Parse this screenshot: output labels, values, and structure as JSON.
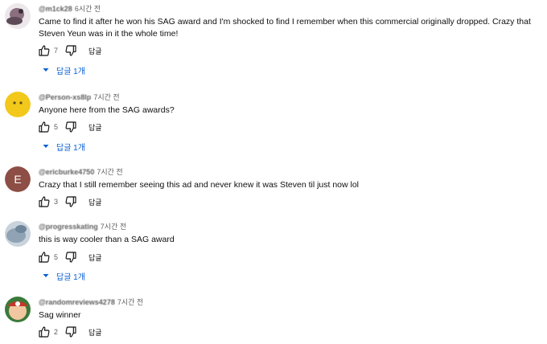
{
  "comments": [
    {
      "author": "@m1ck28",
      "time": "6시간 전",
      "text": "Came to find it after he won his SAG award and I'm shocked to find I remember when this commercial originally dropped. Crazy that Steven Yeun was in it the whole time!",
      "likes": "7",
      "reply_label": "답글",
      "replies_label": "답글 1개",
      "avatar": {
        "type": "image",
        "color": "#8a6f7f"
      }
    },
    {
      "author": "@Person-xs8lp",
      "time": "7시간 전",
      "text": "Anyone here from the SAG awards?",
      "likes": "5",
      "reply_label": "답글",
      "replies_label": "답글 1개",
      "avatar": {
        "type": "emoji",
        "color": "#f2c81a"
      }
    },
    {
      "author": "@ericburke4750",
      "time": "7시간 전",
      "text": "Crazy that I still remember seeing this ad and never knew it was Steven til just now lol",
      "likes": "3",
      "reply_label": "답글",
      "replies_label": "",
      "avatar": {
        "type": "letter",
        "letter": "E",
        "color": "#8d4e45"
      }
    },
    {
      "author": "@progresskating",
      "time": "7시간 전",
      "text": "this is way cooler than a SAG award",
      "likes": "5",
      "reply_label": "답글",
      "replies_label": "답글 1개",
      "avatar": {
        "type": "image",
        "color": "#8fa3b5"
      }
    },
    {
      "author": "@randomreviews4278",
      "time": "7시간 전",
      "text": "Sag winner",
      "likes": "2",
      "reply_label": "답글",
      "replies_label": "",
      "avatar": {
        "type": "image",
        "color": "#c0392b"
      }
    }
  ],
  "icons": {
    "like": "thumb-up-icon",
    "dislike": "thumb-down-icon",
    "caret": "caret-down-icon"
  },
  "colors": {
    "link_blue": "#065fd4",
    "secondary_text": "#606060"
  }
}
